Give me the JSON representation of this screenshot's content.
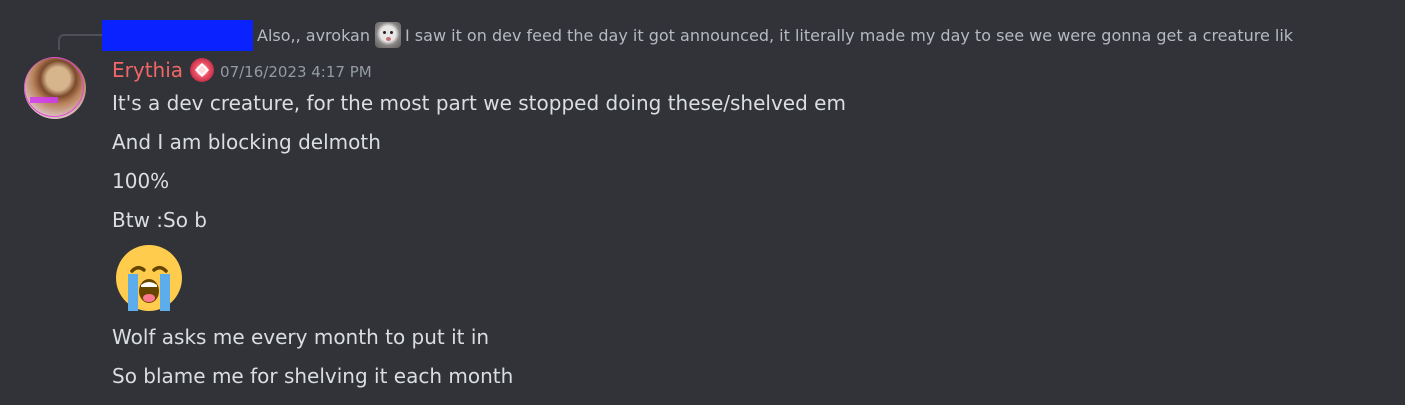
{
  "reply": {
    "text": "Also,, avrokan",
    "emoji_name": "pug-face-emoji",
    "text_after": "I saw it on dev feed the day it got announced, it literally made my day to see we were gonna get a creature lik"
  },
  "message": {
    "username": "Erythia",
    "timestamp": "07/16/2023 4:17 PM",
    "username_color": "#f06767",
    "lines_before_emoji": [
      "It's a dev creature, for the most part we stopped doing these/shelved em",
      "And I am blocking delmoth",
      "100%",
      "Btw :So b"
    ],
    "jumbo_emoji": "loudly-crying-face",
    "lines_after_emoji": [
      "Wolf asks me every month to put it in",
      "So blame me for shelving it each month"
    ]
  },
  "colors": {
    "background": "#313338",
    "text": "#dbdee1",
    "muted": "#949ba4",
    "redaction": "#0a22ff"
  }
}
